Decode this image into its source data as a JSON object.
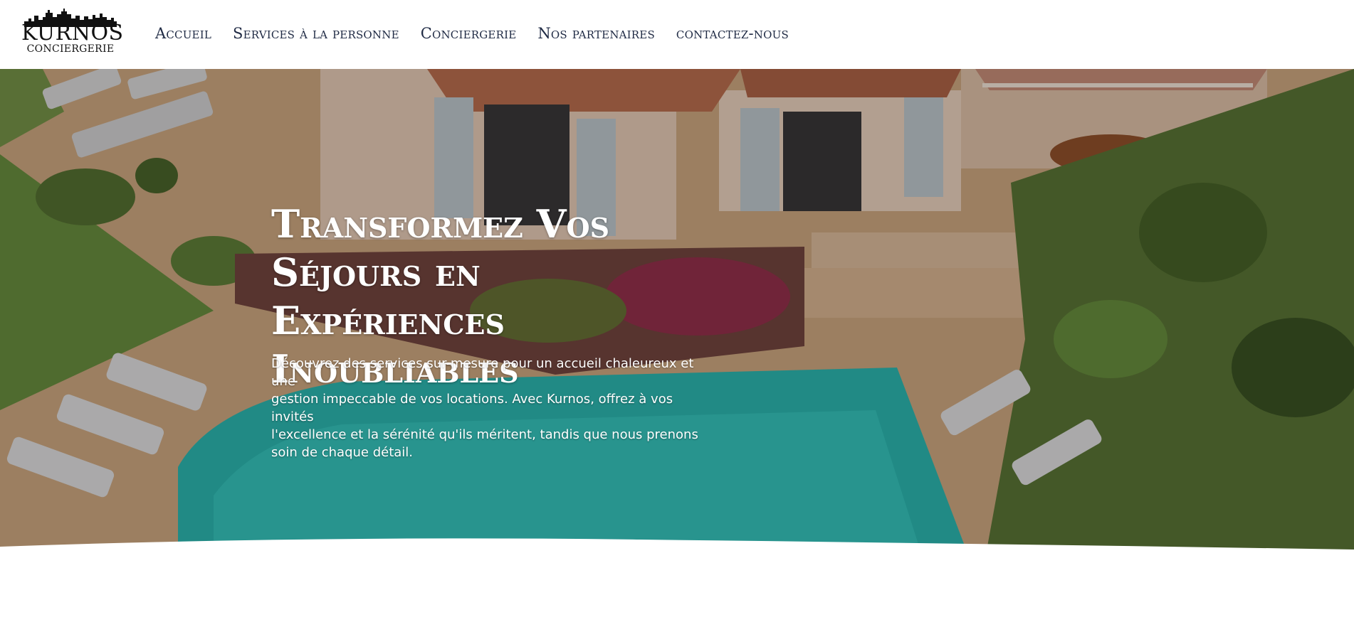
{
  "header": {
    "logo": {
      "name": "KURNOS",
      "subtitle": "CONCIERGERIE",
      "icon": "city-skyline-icon"
    },
    "nav": [
      {
        "label": "Accueil"
      },
      {
        "label": "Services à la personne"
      },
      {
        "label": "Conciergerie"
      },
      {
        "label": "Nos partenaires"
      },
      {
        "label": "contactez-nous"
      }
    ]
  },
  "hero": {
    "title_lines": [
      "Transformez Vos",
      "Séjours en Expériences",
      "Inoubliables"
    ],
    "description_lines": [
      "Découvrez des services sur-mesure pour un accueil chaleureux et une",
      "gestion impeccable de vos locations. Avec Kurnos, offrez à vos invités",
      "l'excellence et la sérénité qu'ils méritent, tandis que nous prenons",
      "soin de chaque détail."
    ],
    "background_image": "villa-with-pool-aerial-photo"
  },
  "colors": {
    "nav_text": "#1f2a44",
    "hero_text": "#ffffff",
    "pool": "#1fb5b0",
    "terrace": "#c9a57f"
  }
}
